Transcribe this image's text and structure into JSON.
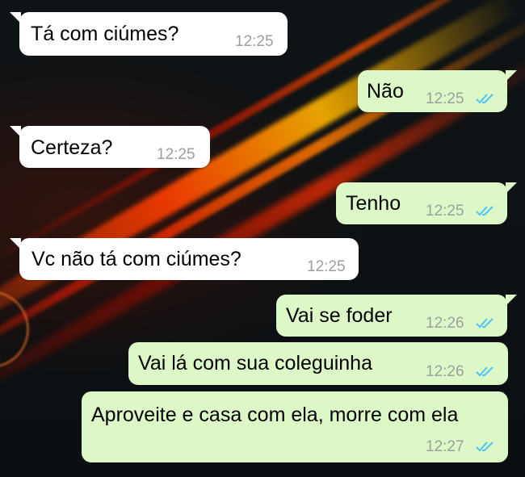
{
  "theme": {
    "incoming_bg": "#ffffff",
    "outgoing_bg": "#dcf8c6",
    "tick_color": "#4fc3f7"
  },
  "messages": [
    {
      "direction": "incoming",
      "text": "Tá com ciúmes?",
      "time": "12:25"
    },
    {
      "direction": "outgoing",
      "text": "Não",
      "time": "12:25",
      "status_icon": "double-check-icon"
    },
    {
      "direction": "incoming",
      "text": "Certeza?",
      "time": "12:25"
    },
    {
      "direction": "outgoing",
      "text": "Tenho",
      "time": "12:25",
      "status_icon": "double-check-icon"
    },
    {
      "direction": "incoming",
      "text": "Vc não tá com ciúmes?",
      "time": "12:25"
    },
    {
      "direction": "outgoing",
      "text": "Vai se foder",
      "time": "12:26",
      "status_icon": "double-check-icon"
    },
    {
      "direction": "outgoing",
      "text": "Vai lá com sua coleguinha",
      "time": "12:26",
      "status_icon": "double-check-icon"
    },
    {
      "direction": "outgoing",
      "text": "Aproveite e casa com ela, morre com ela",
      "time": "12:27",
      "status_icon": "double-check-icon"
    }
  ]
}
